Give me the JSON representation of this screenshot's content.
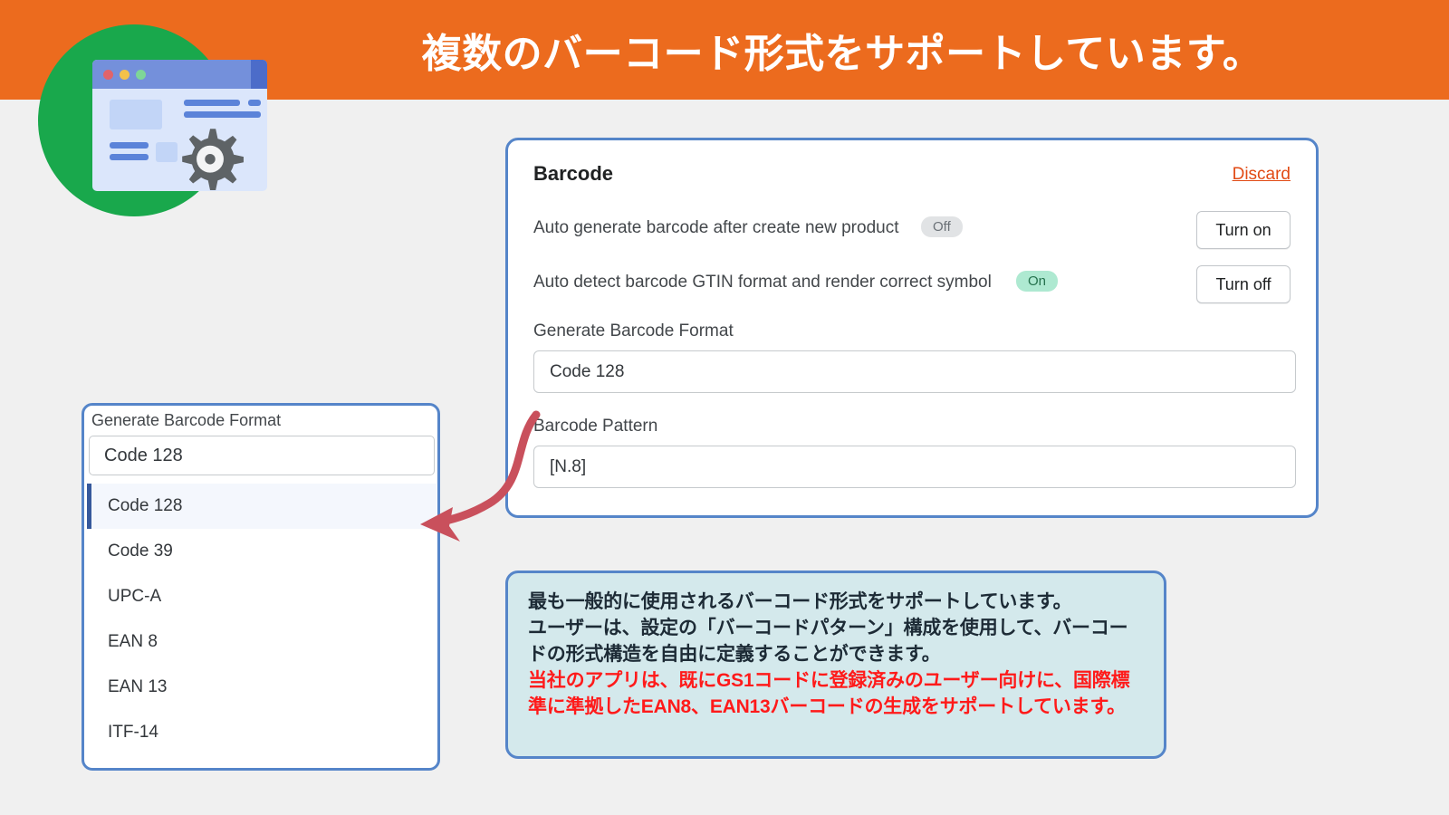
{
  "header": {
    "title": "複数のバーコード形式をサポートしています。",
    "background_color": "#ec6b1e",
    "title_color": "#ffffff"
  },
  "logo": {
    "name": "app-settings-logo",
    "circle_color": "#19a84c",
    "browser_chrome_color": "#7490db",
    "gear_color": "#5e6366"
  },
  "settings_card": {
    "title": "Barcode",
    "discard_label": "Discard",
    "discard_color": "#e14a14",
    "border_color": "#5585c9",
    "rows": [
      {
        "label": "Auto generate barcode after create new product",
        "badge": "Off",
        "badge_color": "#e1e3e5",
        "button": "Turn on"
      },
      {
        "label": "Auto detect barcode GTIN format and render correct symbol",
        "badge": "On",
        "badge_color": "#aee9d1",
        "button": "Turn off"
      }
    ],
    "fields": [
      {
        "label": "Generate Barcode Format",
        "value": "Code 128"
      },
      {
        "label": "Barcode Pattern",
        "value": "[N.8]"
      }
    ]
  },
  "dropdown": {
    "label": "Generate Barcode Format",
    "selected_value": "Code 128",
    "border_color": "#5585c9",
    "highlight_color": "#f4f7fd",
    "accent_color": "#36599c",
    "options": [
      {
        "label": "Code 128",
        "selected": true
      },
      {
        "label": "Code 39",
        "selected": false
      },
      {
        "label": "UPC-A",
        "selected": false
      },
      {
        "label": "EAN 8",
        "selected": false
      },
      {
        "label": "EAN 13",
        "selected": false
      },
      {
        "label": "ITF-14",
        "selected": false
      }
    ]
  },
  "annotation_arrow": {
    "name": "curved-arrow-pointing-to-dropdown",
    "color": "#c9505c"
  },
  "callout": {
    "background_color": "#d4e9ec",
    "border_color": "#5585c9",
    "lines": [
      {
        "text": "最も一般的に使用されるバーコード形式をサポートしています。",
        "color": "#1d2b36"
      },
      {
        "text": "ユーザーは、設定の「バーコードパターン」構成を使用して、バーコードの形式構造を自由に定義することができます。",
        "color": "#1d2b36"
      },
      {
        "text": "当社のアプリは、既にGS1コードに登録済みのユーザー向けに、国際標準に準拠したEAN8、EAN13バーコードの生成をサポートしています。",
        "color": "#ff1a1a"
      }
    ]
  }
}
